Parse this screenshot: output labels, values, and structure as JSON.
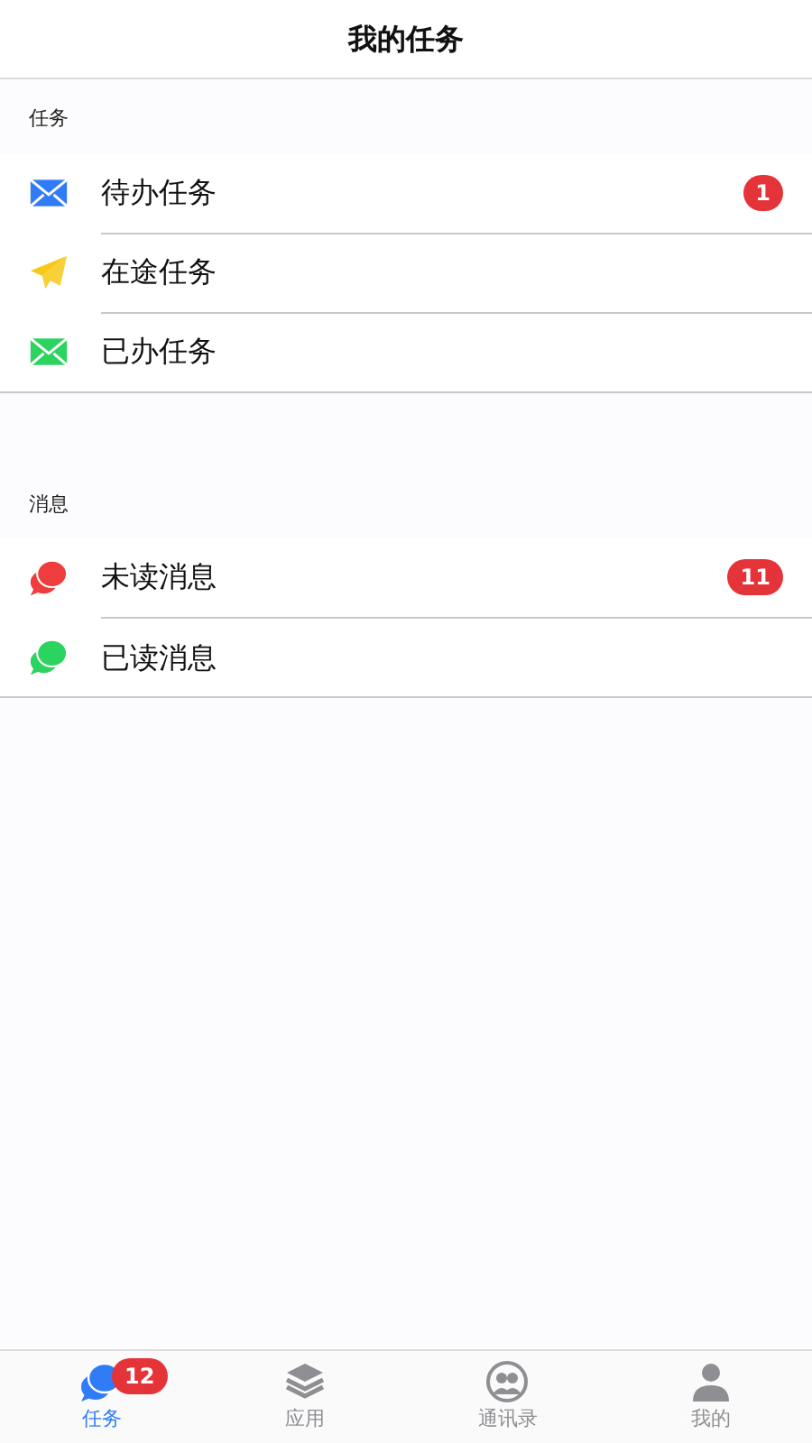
{
  "header": {
    "title": "我的任务"
  },
  "sections": [
    {
      "title": "任务",
      "items": [
        {
          "kind": "envelope",
          "color": "#2f7cf6",
          "label": "待办任务",
          "badge": "1"
        },
        {
          "kind": "plane",
          "color": "#f7c815",
          "label": "在途任务"
        },
        {
          "kind": "envelope",
          "color": "#2bd35f",
          "label": "已办任务"
        }
      ]
    },
    {
      "title": "消息",
      "items": [
        {
          "kind": "chat",
          "color": "#ef3d3d",
          "label": "未读消息",
          "badge": "11"
        },
        {
          "kind": "chat",
          "color": "#2bd35f",
          "label": "已读消息"
        }
      ]
    }
  ],
  "tabs": [
    {
      "kind": "chat",
      "label": "任务",
      "selected": true,
      "badge": "12"
    },
    {
      "kind": "layers",
      "label": "应用",
      "selected": false
    },
    {
      "kind": "contacts",
      "label": "通讯录",
      "selected": false
    },
    {
      "kind": "person",
      "label": "我的",
      "selected": false
    }
  ]
}
